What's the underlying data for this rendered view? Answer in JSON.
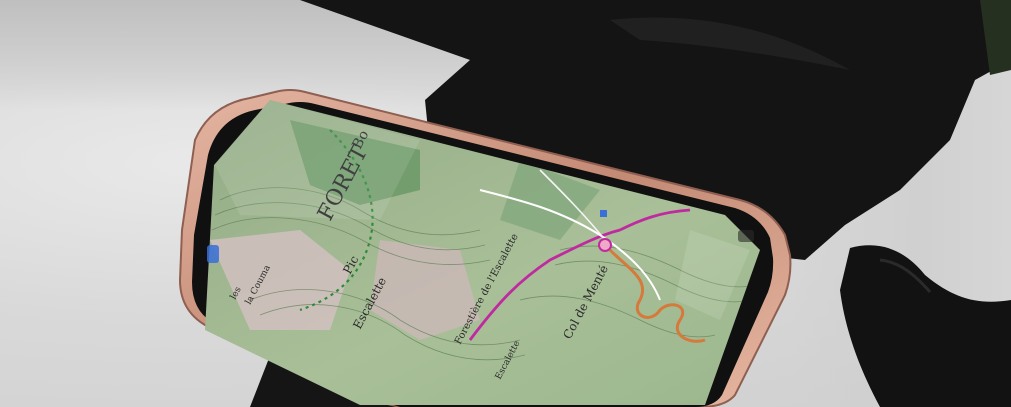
{
  "scene": {
    "description_alt": "",
    "map_labels": {
      "forest_name": "FORET",
      "forest_suffix": "Bo",
      "peak": "Pic",
      "peak_name": "Escalette",
      "pass_label": "Col de Menté",
      "trail_label": "Forestière de l'Escalette",
      "corner_label_1": "la Couma",
      "corner_label_2": "les",
      "side_label": "Escalette"
    },
    "colors": {
      "glove": "#141414",
      "phone_frame": "#c9927e",
      "map_green": "#9fb88f",
      "map_dark_green": "#6f9a6a",
      "map_pink": "#d8c1c6",
      "trail_magenta": "#c02aa0",
      "road_orange": "#d57a3b",
      "water_blue": "#3a6fd8"
    }
  }
}
